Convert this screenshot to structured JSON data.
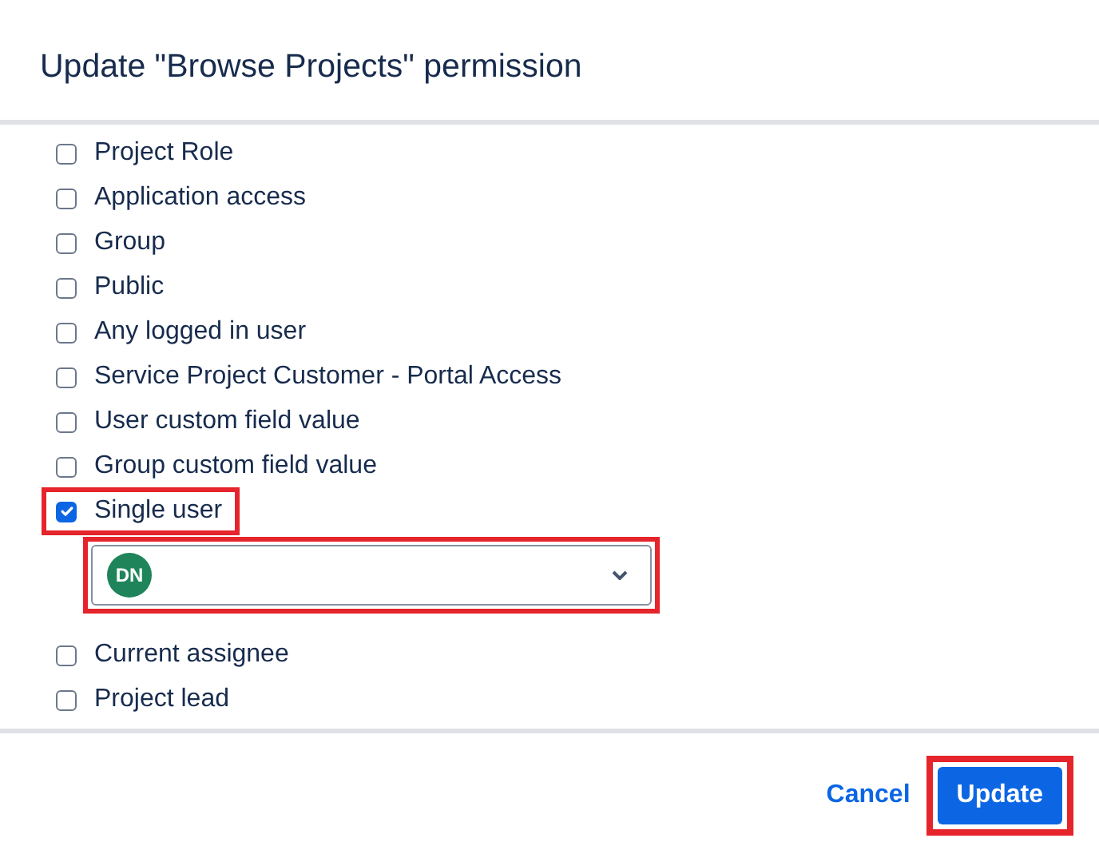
{
  "dialog": {
    "title": "Update \"Browse Projects\" permission"
  },
  "options": [
    {
      "label": "Project Role",
      "checked": false,
      "highlighted": false
    },
    {
      "label": "Application access",
      "checked": false,
      "highlighted": false
    },
    {
      "label": "Group",
      "checked": false,
      "highlighted": false
    },
    {
      "label": "Public",
      "checked": false,
      "highlighted": false
    },
    {
      "label": "Any logged in user",
      "checked": false,
      "highlighted": false
    },
    {
      "label": "Service Project Customer - Portal Access",
      "checked": false,
      "highlighted": false
    },
    {
      "label": "User custom field value",
      "checked": false,
      "highlighted": false
    },
    {
      "label": "Group custom field value",
      "checked": false,
      "highlighted": false
    },
    {
      "label": "Single user",
      "checked": true,
      "highlighted": true,
      "user_picker": {
        "avatar_initials": "DN",
        "highlighted": true
      }
    },
    {
      "label": "Current assignee",
      "checked": false,
      "highlighted": false
    },
    {
      "label": "Project lead",
      "checked": false,
      "highlighted": false
    }
  ],
  "footer": {
    "cancel": "Cancel",
    "submit": {
      "label": "Update",
      "highlighted": true
    }
  }
}
